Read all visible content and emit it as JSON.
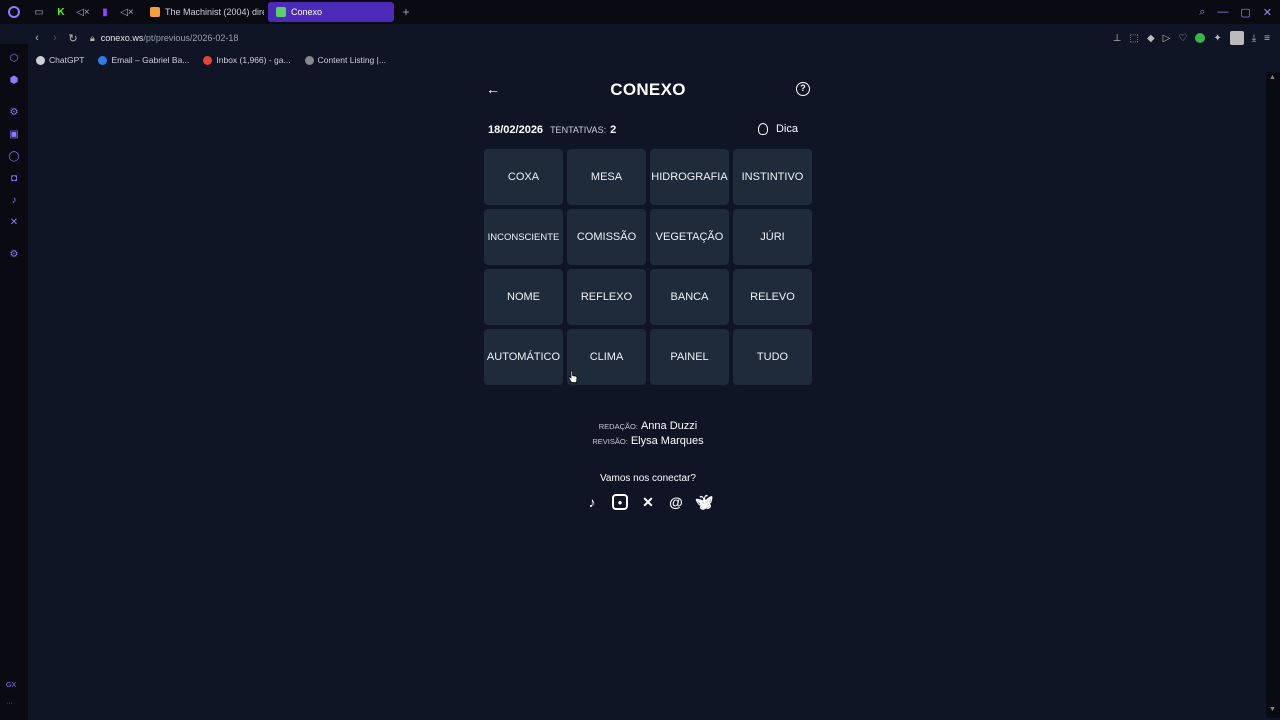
{
  "browser": {
    "tabs": [
      {
        "label": "The Machinist (2004) dire",
        "fav_color": "#f2a03a",
        "active": false
      },
      {
        "label": "Conexo",
        "fav_color": "#5ad06b",
        "active": true
      }
    ],
    "url_domain": "conexo.ws",
    "url_path": "/pt/previous/2026-02-18",
    "bookmarks": [
      {
        "label": "ChatGPT",
        "color": "#d0d0d0"
      },
      {
        "label": "Email – Gabriel Ba...",
        "color": "#2b7de9"
      },
      {
        "label": "Inbox (1,966) - ga...",
        "color": "#ea4335"
      },
      {
        "label": "Content Listing |...",
        "color": "#888888"
      }
    ],
    "sidebar_bottom": "GX"
  },
  "game": {
    "title": "CONEXO",
    "date": "18/02/2026",
    "tries_label": "TENTATIVAS:",
    "tries_value": "2",
    "hint_label": "Dica",
    "words": [
      "COXA",
      "MESA",
      "HIDROGRAFIA",
      "INSTINTIVO",
      "INCONSCIENTE",
      "COMISSÃO",
      "VEGETAÇÃO",
      "JÚRI",
      "NOME",
      "REFLEXO",
      "BANCA",
      "RELEVO",
      "AUTOMÁTICO",
      "CLIMA",
      "PAINEL",
      "TUDO"
    ]
  },
  "credits": {
    "redacao_label": "REDAÇÃO:",
    "redacao_name": "Anna Duzzi",
    "revisao_label": "REVISÃO:",
    "revisao_name": "Elysa Marques"
  },
  "connect": {
    "label": "Vamos nos conectar?",
    "icons": [
      "tiktok-icon",
      "instagram-icon",
      "x-icon",
      "threads-icon",
      "bluesky-icon"
    ]
  }
}
